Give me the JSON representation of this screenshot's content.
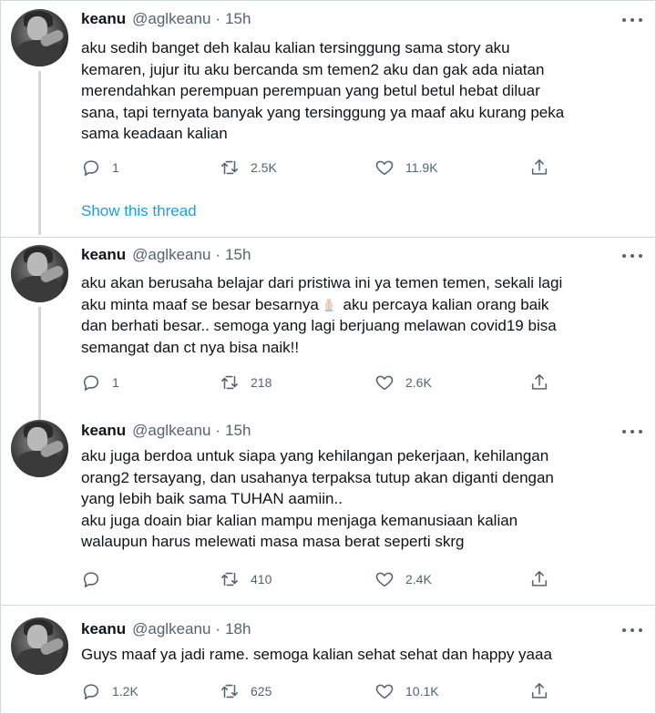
{
  "show_thread_label": "Show this thread",
  "tweets": [
    {
      "name": "keanu",
      "handle": "@aglkeanu",
      "dot": "·",
      "time": "15h",
      "lines": [
        "aku sedih banget deh kalau kalian tersinggung sama story aku",
        "kemaren, jujur itu aku bercanda sm temen2 aku dan gak ada niatan",
        "merendahkan perempuan perempuan yang betul betul hebat diluar",
        "sana, tapi ternyata banyak yang tersinggung ya maaf aku kurang peka",
        "sama keadaan kalian"
      ],
      "replies": "1",
      "retweets": "2.5K",
      "likes": "11.9K"
    },
    {
      "name": "keanu",
      "handle": "@aglkeanu",
      "dot": "·",
      "time": "15h",
      "lines": [
        "aku akan berusaha belajar dari pristiwa ini ya temen temen, sekali lagi",
        "aku minta maaf se besar besarnya",
        " aku percaya kalian orang baik",
        "dan berhati besar.. semoga yang lagi berjuang melawan covid19 bisa",
        "semangat dan ct nya bisa naik!!"
      ],
      "replies": "1",
      "retweets": "218",
      "likes": "2.6K"
    },
    {
      "name": "keanu",
      "handle": "@aglkeanu",
      "dot": "·",
      "time": "15h",
      "lines": [
        "aku juga berdoa untuk siapa yang kehilangan pekerjaan, kehilangan",
        "orang2 tersayang, dan usahanya terpaksa tutup akan diganti dengan",
        "yang lebih baik sama TUHAN aamiin..",
        "aku juga doain biar kalian mampu menjaga kemanusiaan kalian",
        "walaupun harus melewati masa masa berat seperti skrg"
      ],
      "replies": "",
      "retweets": "410",
      "likes": "2.4K"
    },
    {
      "name": "keanu",
      "handle": "@aglkeanu",
      "dot": "·",
      "time": "18h",
      "lines": [
        "Guys maaf ya jadi rame. semoga kalian sehat sehat dan happy yaaa"
      ],
      "replies": "1.2K",
      "retweets": "625",
      "likes": "10.1K"
    }
  ],
  "icons": {
    "reply": "reply-icon",
    "retweet": "retweet-icon",
    "like": "heart-icon",
    "share": "share-icon",
    "more": "more-icon",
    "emoji": "folded-hands-emoji"
  },
  "colors": {
    "text": "#0f1419",
    "secondary": "#536471",
    "link": "#1d9bf0",
    "border": "#cfd9de"
  }
}
